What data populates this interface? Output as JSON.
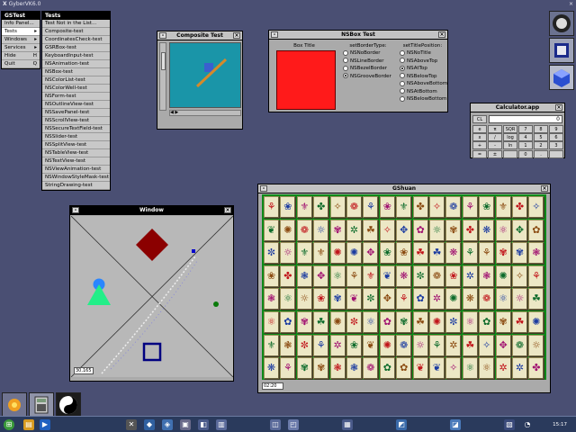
{
  "topbar": {
    "title": "GyberVK6.0"
  },
  "main_menu": {
    "title": "GSTest",
    "items": [
      {
        "label": "Info Panel...",
        "arrow": ""
      },
      {
        "label": "Tests",
        "arrow": "▸"
      },
      {
        "label": "Windows",
        "arrow": "▸"
      },
      {
        "label": "Services",
        "arrow": "▸"
      },
      {
        "label": "Hide",
        "arrow": "H"
      },
      {
        "label": "Quit",
        "arrow": "Q"
      }
    ]
  },
  "tests_menu": {
    "title": "Tests",
    "items": [
      "Test Not in the List...",
      "Composite-test",
      "CoordinatesCheck-test",
      "GSRBox-test",
      "KeyboardInput-test",
      "NSAnimation-test",
      "NSBox-test",
      "NSColorList-test",
      "NSColorWell-test",
      "NSForm-test",
      "NSOutlineView-test",
      "NSSavePanel-test",
      "NSScrollView-test",
      "NSSecureTextField-test",
      "NSSlider-test",
      "NSSplitView-test",
      "NSTableView-test",
      "NSTextView-test",
      "NSViewAnimation-test",
      "NSWindowStyleMask-test",
      "StringDrawing-test"
    ]
  },
  "composite": {
    "title": "Composite Test",
    "close": "×",
    "mini": "-",
    "hbar": "◀ ▶"
  },
  "nsbox": {
    "title": "NSBox Test",
    "box_title": "Box Title",
    "border_header": "setBorderType:",
    "border_options": [
      "NSNoBorder",
      "NSLineBorder",
      "NSBezelBorder",
      "NSGrooveBorder"
    ],
    "border_selected": 3,
    "titlepos_header": "setTitlePosition:",
    "titlepos_options": [
      "NSNoTitle",
      "NSAboveTop",
      "NSAtTop",
      "NSBelowTop",
      "NSAboveBottom",
      "NSAtBottom",
      "NSBelowBottom"
    ],
    "titlepos_selected": 2
  },
  "calculator": {
    "title": "Calculator.app",
    "display": "0",
    "clear_label": "CL",
    "keys": [
      "e",
      "π",
      "SQR",
      "7",
      "8",
      "9",
      "x",
      "/",
      "log",
      "4",
      "5",
      "6",
      "+",
      "-",
      "ln",
      "1",
      "2",
      "3",
      "=",
      "±",
      "",
      "0",
      ".",
      ""
    ]
  },
  "draw_window": {
    "title": "Window",
    "coord": "30,165"
  },
  "gshuan": {
    "title": "GShuan",
    "status": "02:20",
    "glyphs": [
      "⚘",
      "☼",
      "✿",
      "❀",
      "✲",
      "✾",
      "⚜",
      "❦",
      "☘",
      "✤",
      "❃",
      "✺",
      "✧",
      "❋",
      "✼",
      "❁",
      "✥",
      "⚛"
    ]
  },
  "taskbar": {
    "clock": "15:17"
  },
  "colors": {
    "desktop": "#4a4f73",
    "nsbox_red": "#ff1a1a",
    "diamond": "#8b0000",
    "teal": "#1a95a8",
    "board_green": "#0c8a18"
  }
}
